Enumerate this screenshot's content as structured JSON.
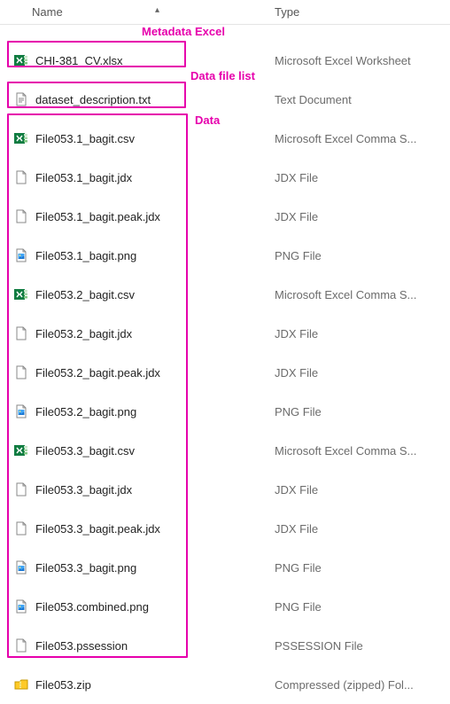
{
  "columns": {
    "name": "Name",
    "type": "Type"
  },
  "annotations": {
    "metadata_excel": "Metadata Excel",
    "data_file_list": "Data file list",
    "data": "Data"
  },
  "icons": {
    "excel": "excel",
    "text": "text",
    "plain": "plain",
    "png": "png",
    "zip": "zip"
  },
  "files": [
    {
      "name": "CHI-381_CV.xlsx",
      "type": "Microsoft Excel Worksheet",
      "icon": "excel"
    },
    {
      "name": "dataset_description.txt",
      "type": "Text Document",
      "icon": "text"
    },
    {
      "name": "File053.1_bagit.csv",
      "type": "Microsoft Excel Comma S...",
      "icon": "excel"
    },
    {
      "name": "File053.1_bagit.jdx",
      "type": "JDX File",
      "icon": "plain"
    },
    {
      "name": "File053.1_bagit.peak.jdx",
      "type": "JDX File",
      "icon": "plain"
    },
    {
      "name": "File053.1_bagit.png",
      "type": "PNG File",
      "icon": "png"
    },
    {
      "name": "File053.2_bagit.csv",
      "type": "Microsoft Excel Comma S...",
      "icon": "excel"
    },
    {
      "name": "File053.2_bagit.jdx",
      "type": "JDX File",
      "icon": "plain"
    },
    {
      "name": "File053.2_bagit.peak.jdx",
      "type": "JDX File",
      "icon": "plain"
    },
    {
      "name": "File053.2_bagit.png",
      "type": "PNG File",
      "icon": "png"
    },
    {
      "name": "File053.3_bagit.csv",
      "type": "Microsoft Excel Comma S...",
      "icon": "excel"
    },
    {
      "name": "File053.3_bagit.jdx",
      "type": "JDX File",
      "icon": "plain"
    },
    {
      "name": "File053.3_bagit.peak.jdx",
      "type": "JDX File",
      "icon": "plain"
    },
    {
      "name": "File053.3_bagit.png",
      "type": "PNG File",
      "icon": "png"
    },
    {
      "name": "File053.combined.png",
      "type": "PNG File",
      "icon": "png"
    },
    {
      "name": "File053.pssession",
      "type": "PSSESSION File",
      "icon": "plain"
    },
    {
      "name": "File053.zip",
      "type": "Compressed (zipped) Fol...",
      "icon": "zip"
    }
  ]
}
